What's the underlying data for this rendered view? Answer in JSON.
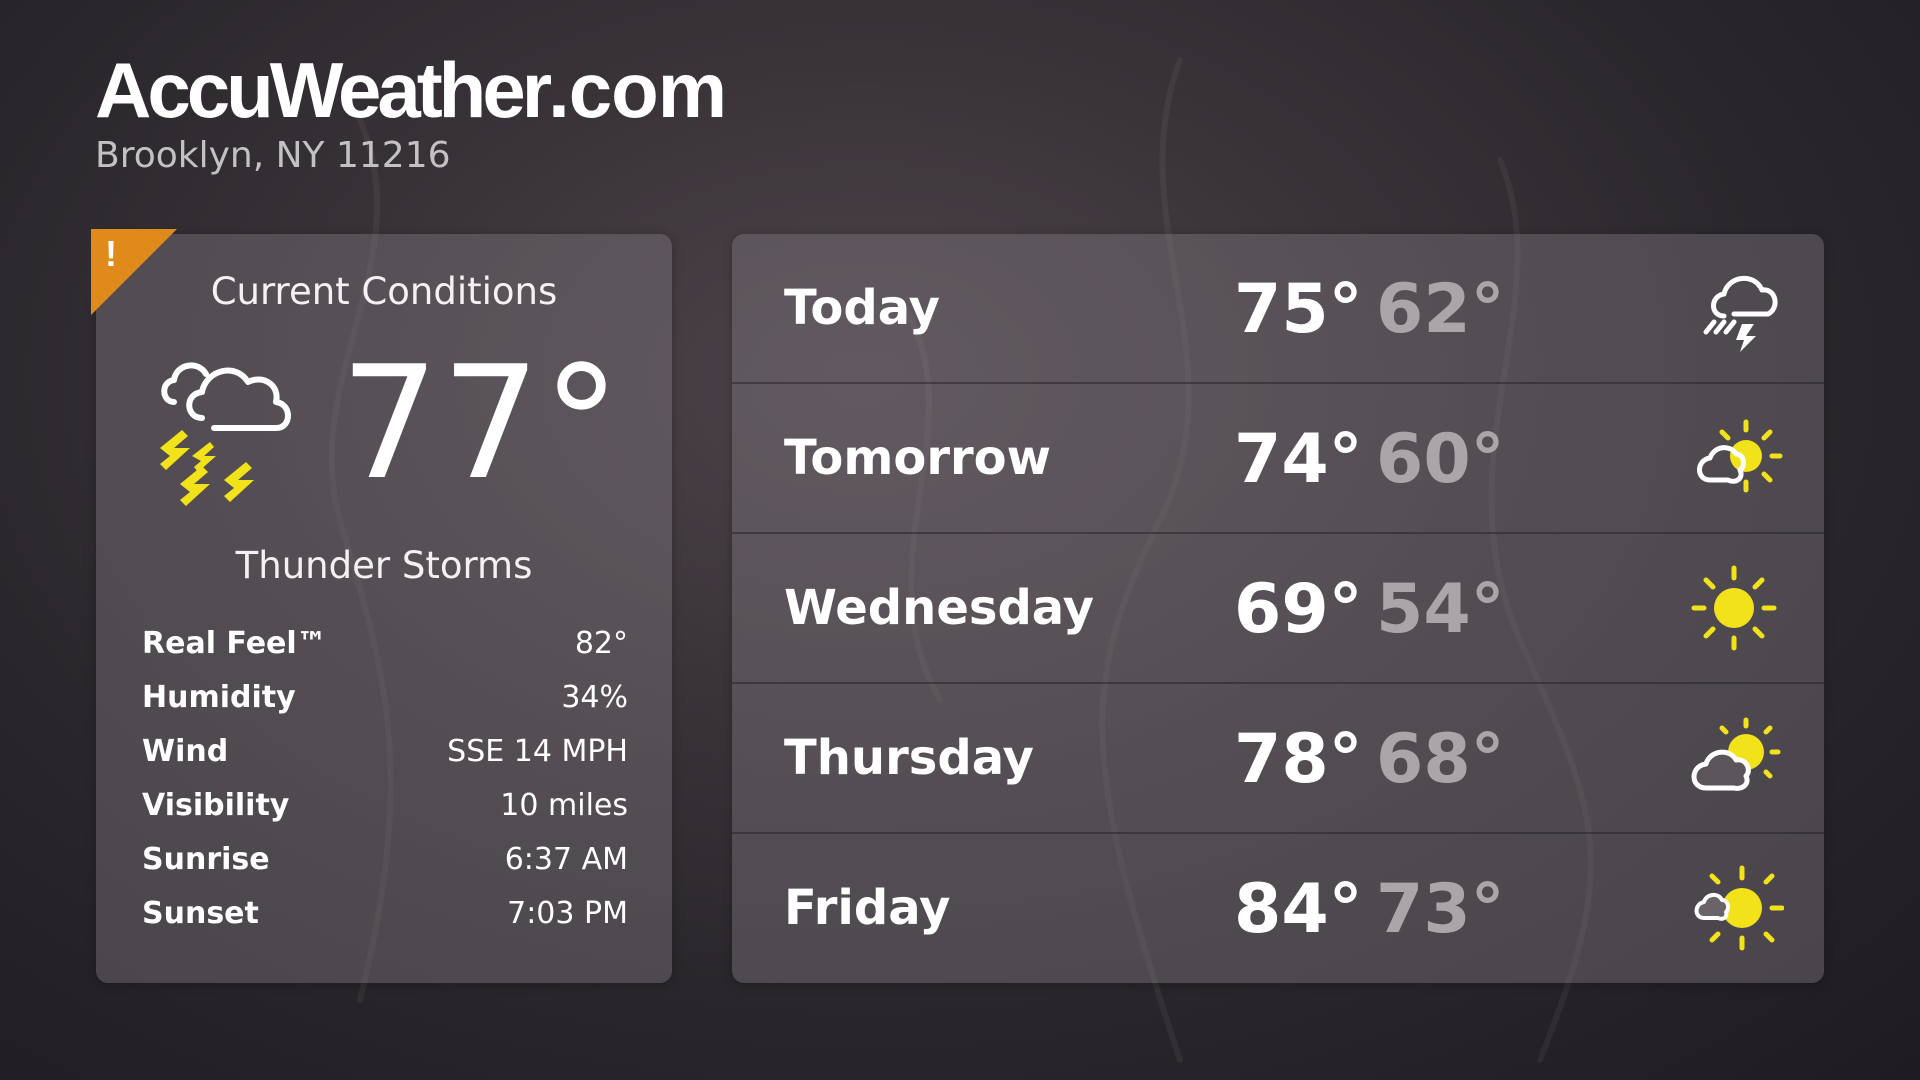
{
  "header": {
    "brand_main": "AccuWeather",
    "brand_suffix": ".com",
    "location": "Brooklyn, NY 11216"
  },
  "alert": {
    "symbol": "!",
    "color": "#e08a1c"
  },
  "current": {
    "title": "Current Conditions",
    "icon": "thunderstorm-icon",
    "temperature": "77°",
    "condition": "Thunder Storms",
    "details": [
      {
        "label": "Real Feel™",
        "value": "82°"
      },
      {
        "label": "Humidity",
        "value": "34%"
      },
      {
        "label": "Wind",
        "value": "SSE 14 MPH"
      },
      {
        "label": "Visibility",
        "value": "10 miles"
      },
      {
        "label": "Sunrise",
        "value": "6:37 AM"
      },
      {
        "label": "Sunset",
        "value": "7:03 PM"
      }
    ]
  },
  "forecast": [
    {
      "day": "Today",
      "high": "75°",
      "low": "62°",
      "icon": "cloud-rain-thunder-icon"
    },
    {
      "day": "Tomorrow",
      "high": "74°",
      "low": "60°",
      "icon": "partly-sunny-icon"
    },
    {
      "day": "Wednesday",
      "high": "69°",
      "low": "54°",
      "icon": "sunny-icon"
    },
    {
      "day": "Thursday",
      "high": "78°",
      "low": "68°",
      "icon": "mostly-cloudy-sun-icon"
    },
    {
      "day": "Friday",
      "high": "84°",
      "low": "73°",
      "icon": "mostly-sunny-icon"
    }
  ],
  "colors": {
    "accent_yellow": "#f2e21a",
    "alert_orange": "#e08a1c",
    "low_temp_gray": "#a9a5a9"
  }
}
